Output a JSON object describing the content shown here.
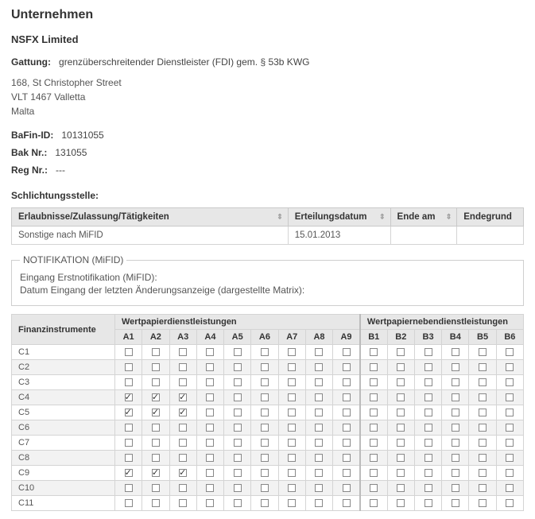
{
  "heading": "Unternehmen",
  "company": "NSFX Limited",
  "gattung_label": "Gattung:",
  "gattung_value": "grenzüberschreitender Dienstleister (FDI) gem. § 53b KWG",
  "address": {
    "line1": "168, St Christopher Street",
    "line2": "VLT 1467 Valletta",
    "line3": "Malta"
  },
  "bafin_label": "BaFin-ID:",
  "bafin_value": "10131055",
  "bak_label": "Bak Nr.:",
  "bak_value": "131055",
  "reg_label": "Reg Nr.:",
  "reg_value": "---",
  "schlicht_label": "Schlichtungsstelle:",
  "table1": {
    "headers": {
      "col1": "Erlaubnisse/Zulassung/Tätigkeiten",
      "col2": "Erteilungsdatum",
      "col3": "Ende am",
      "col4": "Endegrund"
    },
    "row": {
      "col1": "Sonstige nach MiFID",
      "col2": "15.01.2013",
      "col3": "",
      "col4": ""
    }
  },
  "notif": {
    "legend": "NOTIFIKATION (MiFID)",
    "line1": "Eingang Erstnotifikation (MiFID):",
    "line2": "Datum Eingang der letzten Änderungsanzeige (dargestellte Matrix):"
  },
  "matrix": {
    "row_header": "Finanzinstrumente",
    "group1": "Wertpapierdienstleistungen",
    "group2": "Wertpapiernebendienstleistungen",
    "cols": [
      "A1",
      "A2",
      "A3",
      "A4",
      "A5",
      "A6",
      "A7",
      "A8",
      "A9",
      "B1",
      "B2",
      "B3",
      "B4",
      "B5",
      "B6"
    ],
    "rows": [
      "C1",
      "C2",
      "C3",
      "C4",
      "C5",
      "C6",
      "C7",
      "C8",
      "C9",
      "C10",
      "C11"
    ]
  },
  "chart_data": {
    "type": "table",
    "title": "NOTIFIKATION (MiFID) Matrix",
    "row_labels": [
      "C1",
      "C2",
      "C3",
      "C4",
      "C5",
      "C6",
      "C7",
      "C8",
      "C9",
      "C10",
      "C11"
    ],
    "col_labels": [
      "A1",
      "A2",
      "A3",
      "A4",
      "A5",
      "A6",
      "A7",
      "A8",
      "A9",
      "B1",
      "B2",
      "B3",
      "B4",
      "B5",
      "B6"
    ],
    "values": [
      [
        0,
        0,
        0,
        0,
        0,
        0,
        0,
        0,
        0,
        0,
        0,
        0,
        0,
        0,
        0
      ],
      [
        0,
        0,
        0,
        0,
        0,
        0,
        0,
        0,
        0,
        0,
        0,
        0,
        0,
        0,
        0
      ],
      [
        0,
        0,
        0,
        0,
        0,
        0,
        0,
        0,
        0,
        0,
        0,
        0,
        0,
        0,
        0
      ],
      [
        1,
        1,
        1,
        0,
        0,
        0,
        0,
        0,
        0,
        0,
        0,
        0,
        0,
        0,
        0
      ],
      [
        1,
        1,
        1,
        0,
        0,
        0,
        0,
        0,
        0,
        0,
        0,
        0,
        0,
        0,
        0
      ],
      [
        0,
        0,
        0,
        0,
        0,
        0,
        0,
        0,
        0,
        0,
        0,
        0,
        0,
        0,
        0
      ],
      [
        0,
        0,
        0,
        0,
        0,
        0,
        0,
        0,
        0,
        0,
        0,
        0,
        0,
        0,
        0
      ],
      [
        0,
        0,
        0,
        0,
        0,
        0,
        0,
        0,
        0,
        0,
        0,
        0,
        0,
        0,
        0
      ],
      [
        1,
        1,
        1,
        0,
        0,
        0,
        0,
        0,
        0,
        0,
        0,
        0,
        0,
        0,
        0
      ],
      [
        0,
        0,
        0,
        0,
        0,
        0,
        0,
        0,
        0,
        0,
        0,
        0,
        0,
        0,
        0
      ],
      [
        0,
        0,
        0,
        0,
        0,
        0,
        0,
        0,
        0,
        0,
        0,
        0,
        0,
        0,
        0
      ]
    ]
  }
}
